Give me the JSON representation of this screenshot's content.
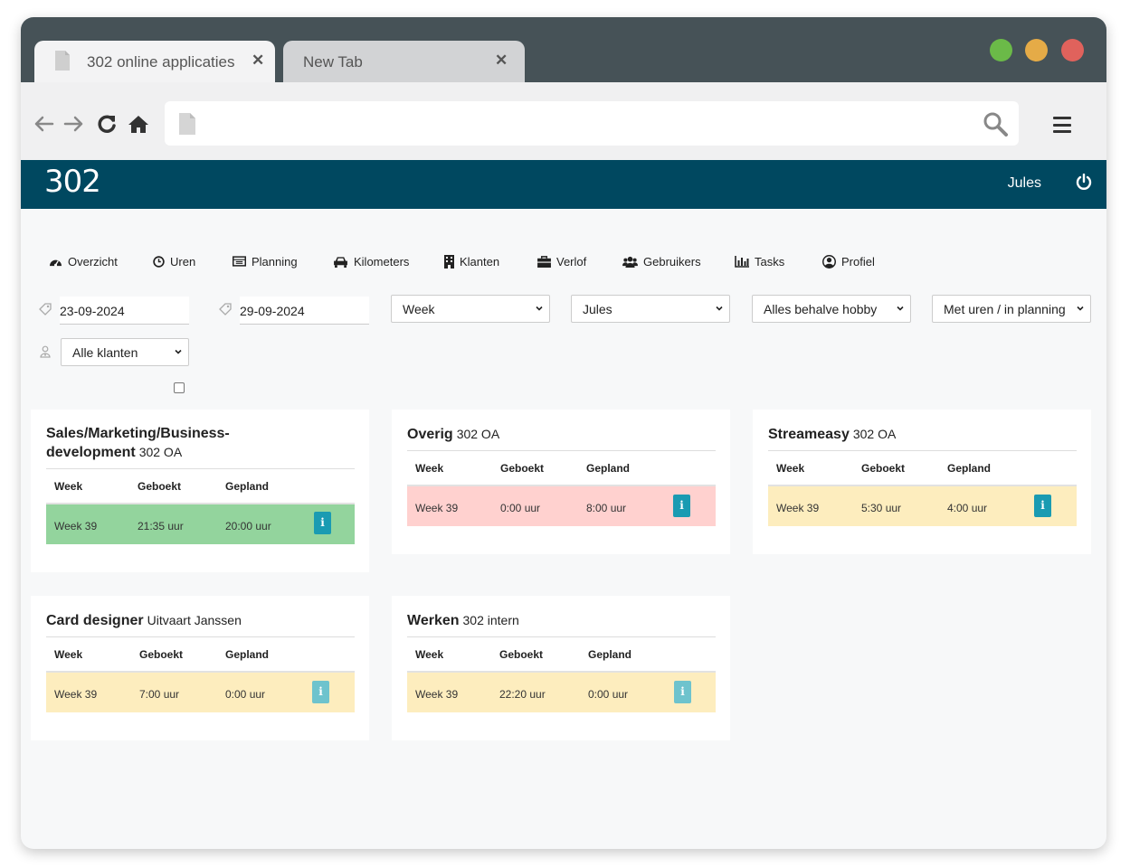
{
  "browser": {
    "tabs": [
      {
        "title": "302 online applicaties",
        "close": "✕"
      },
      {
        "title": "New Tab",
        "close": "✕"
      }
    ],
    "window_dots": [
      "#6bba48",
      "#e5ab47",
      "#e0625c"
    ]
  },
  "app": {
    "logo": "302",
    "user": "Jules",
    "header_color": "#004860"
  },
  "nav": [
    {
      "label": "Overzicht",
      "icon": "dashboard-icon"
    },
    {
      "label": "Uren",
      "icon": "clock-icon"
    },
    {
      "label": "Planning",
      "icon": "calendar-icon"
    },
    {
      "label": "Kilometers",
      "icon": "car-icon"
    },
    {
      "label": "Klanten",
      "icon": "building-icon"
    },
    {
      "label": "Verlof",
      "icon": "briefcase-icon"
    },
    {
      "label": "Gebruikers",
      "icon": "users-icon"
    },
    {
      "label": "Tasks",
      "icon": "bar-chart-icon"
    },
    {
      "label": "Profiel",
      "icon": "user-circle-icon"
    }
  ],
  "filters": {
    "date_from": "23-09-2024",
    "date_to": "29-09-2024",
    "period": "Week",
    "user": "Jules",
    "category": "Alles behalve hobby",
    "mode": "Met uren / in planning",
    "clients": "Alle klanten"
  },
  "table_headers": {
    "week": "Week",
    "booked": "Geboekt",
    "planned": "Gepland"
  },
  "cards": [
    {
      "title_line1": "Sales/Marketing/Business-",
      "title_line2": "development",
      "subtitle": "302 OA",
      "week": "Week 39",
      "booked": "21:35 uur",
      "planned": "20:00 uur",
      "status_color": "#93d49d",
      "info": "i"
    },
    {
      "title": "Overig",
      "subtitle": "302 OA",
      "week": "Week 39",
      "booked": "0:00 uur",
      "planned": "8:00 uur",
      "status_color": "#ffd1cf",
      "info": "i"
    },
    {
      "title": "Streameasy",
      "subtitle": "302 OA",
      "week": "Week 39",
      "booked": "5:30 uur",
      "planned": "4:00 uur",
      "status_color": "#fdedbe",
      "info": "i"
    },
    {
      "title": "Card designer",
      "subtitle": "Uitvaart Janssen",
      "week": "Week 39",
      "booked": "7:00 uur",
      "planned": "0:00 uur",
      "status_color": "#fdedbe",
      "info": "i"
    },
    {
      "title": "Werken",
      "subtitle": "302 intern",
      "week": "Week 39",
      "booked": "22:20 uur",
      "planned": "0:00 uur",
      "status_color": "#fdedbe",
      "info": "i"
    }
  ]
}
